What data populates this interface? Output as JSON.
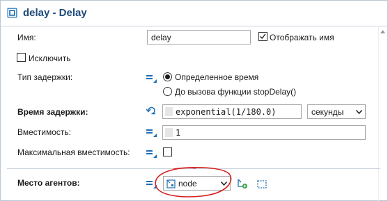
{
  "header": {
    "title": "delay - Delay",
    "icon": "delay-block-icon"
  },
  "fields": {
    "name_label": "Имя:",
    "name_value": "delay",
    "show_name_label": "Отображать имя",
    "show_name_checked": true,
    "exclude_label": "Исключить",
    "exclude_checked": false,
    "delay_type_label": "Тип задержки:",
    "delay_type_options": [
      {
        "label": "Определенное время",
        "selected": true
      },
      {
        "label": "До вызова функции stopDelay()",
        "selected": false
      }
    ],
    "delay_time_label": "Время задержки:",
    "delay_time_value": "exponential(1/180.0)",
    "delay_time_unit": "секунды",
    "capacity_label": "Вместимость:",
    "capacity_value": "1",
    "max_capacity_label": "Максимальная вместимость:",
    "max_capacity_checked": false,
    "agent_location_label": "Место агентов:",
    "agent_location_value": "node"
  },
  "colors": {
    "title": "#1f4a78",
    "accent_blue": "#1f6fb3",
    "highlight_circle": "#d61f1f"
  }
}
